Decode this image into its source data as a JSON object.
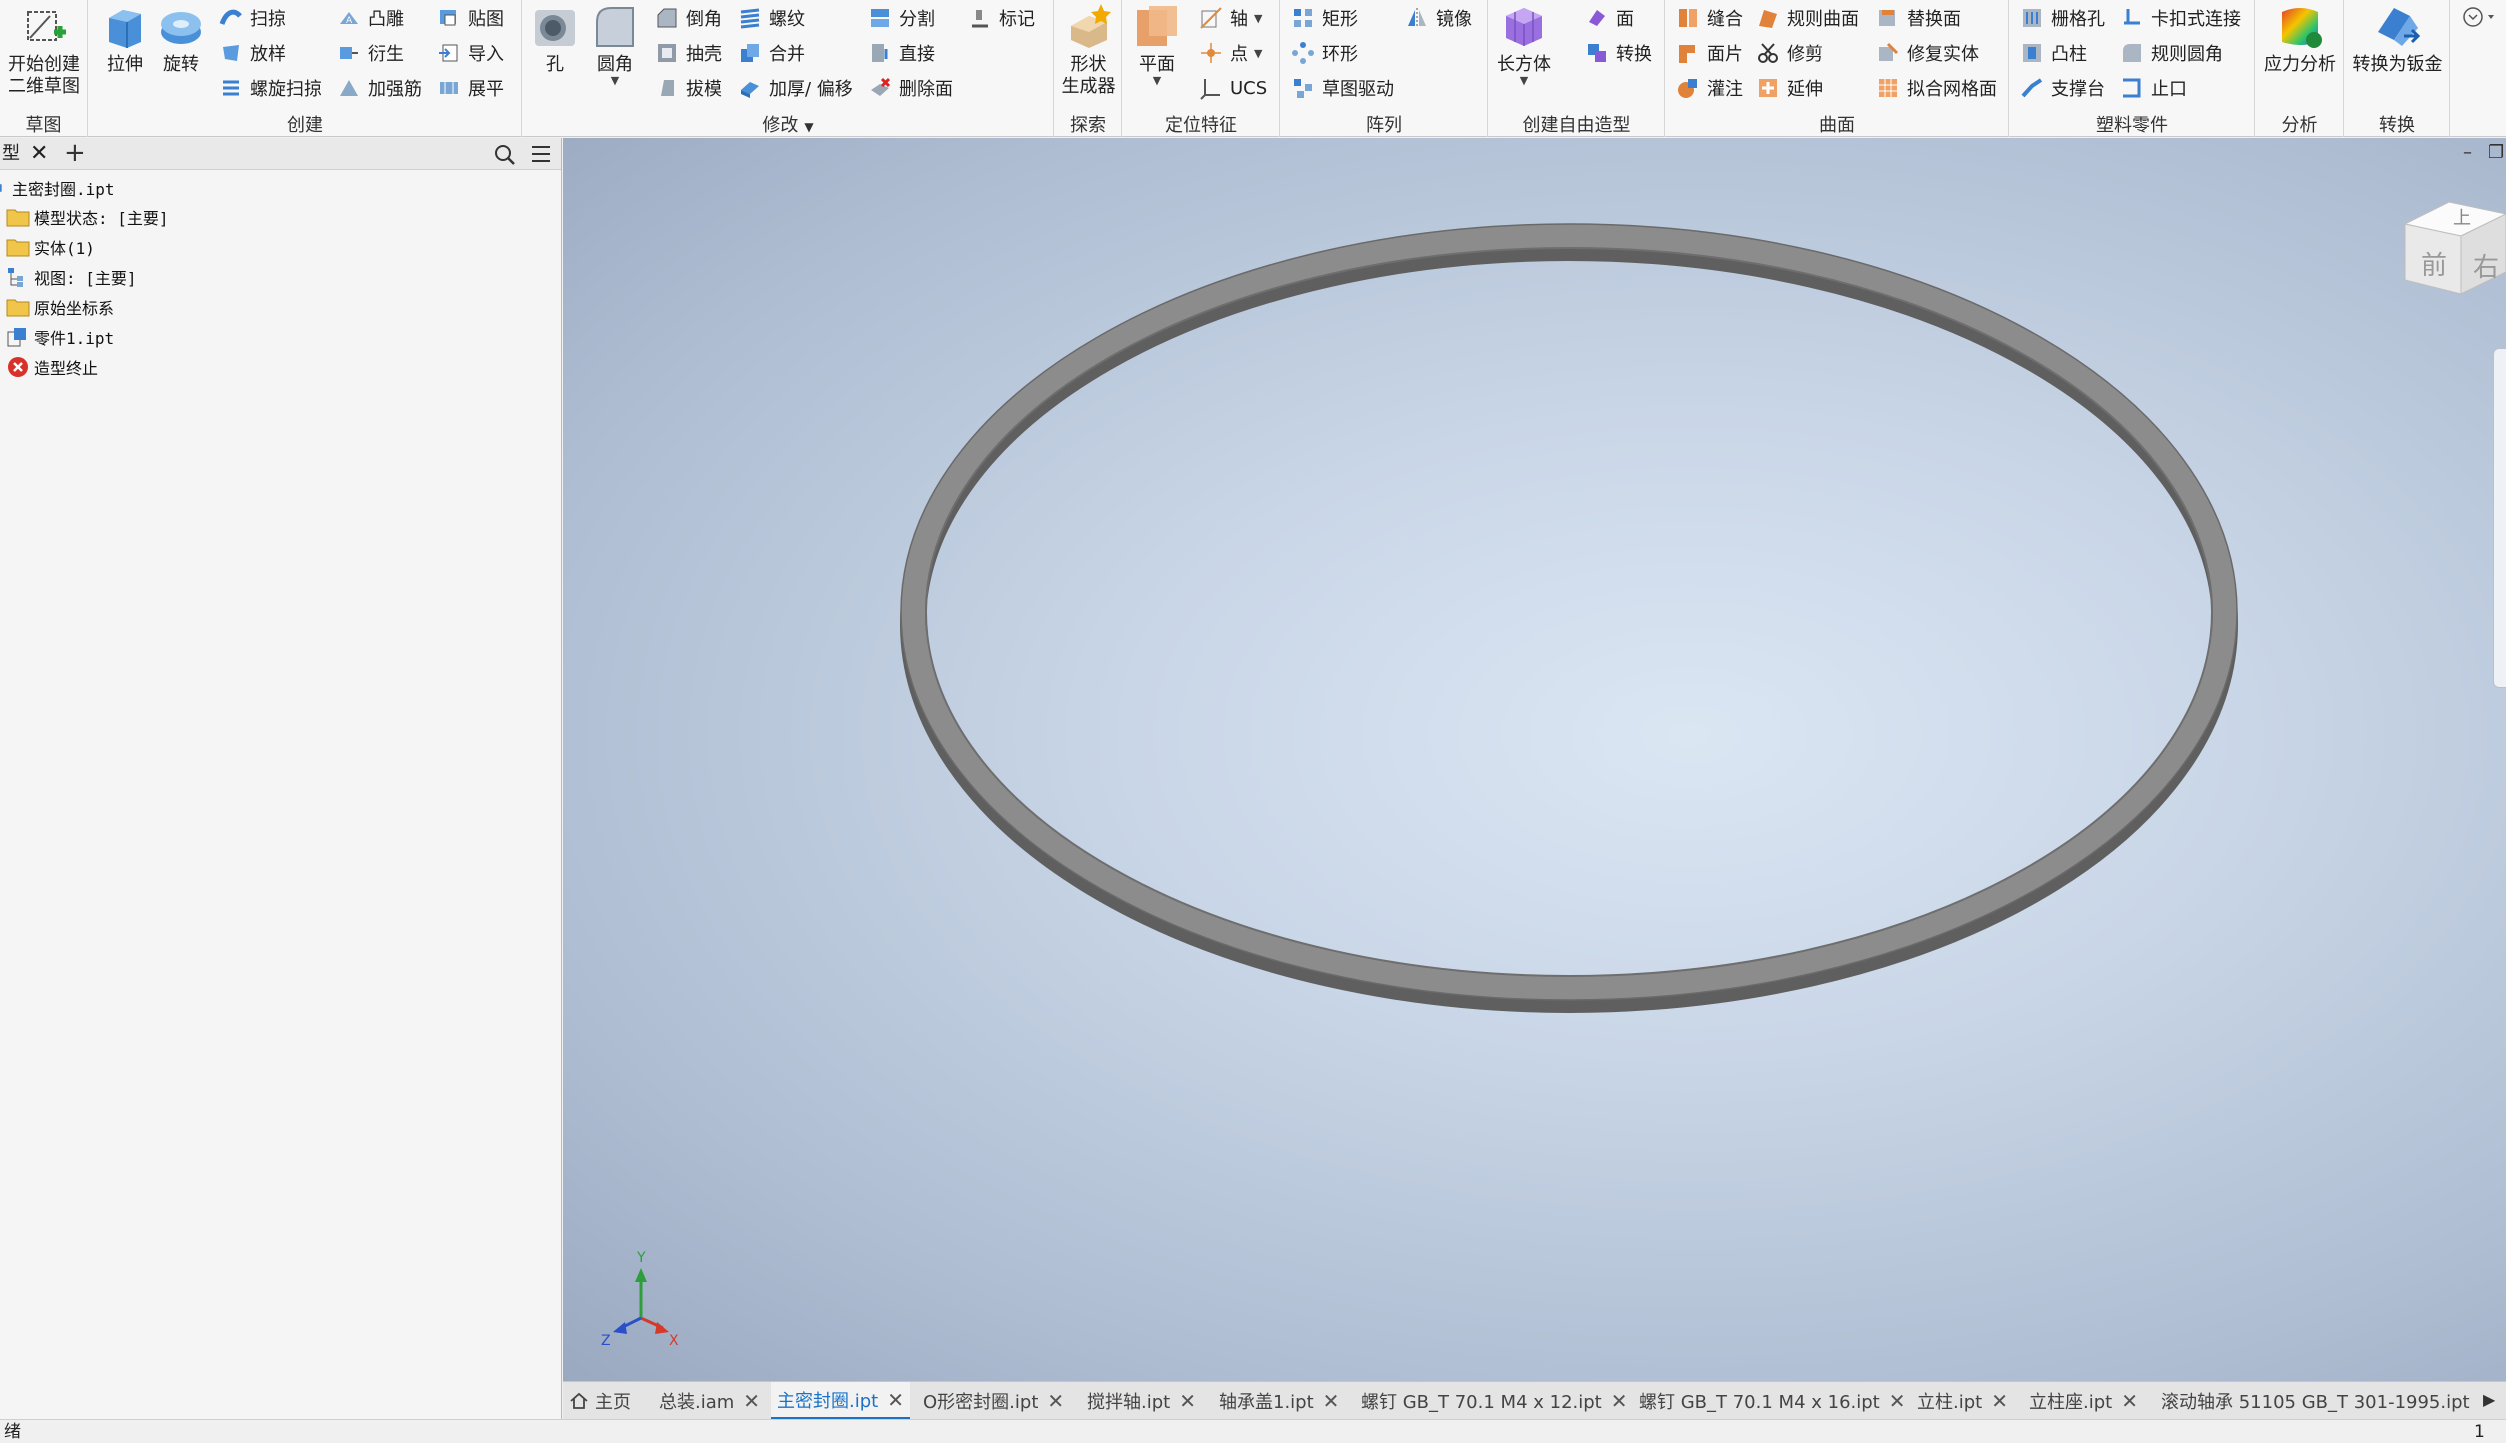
{
  "ribbon": {
    "sketch": {
      "panel_label": "草图",
      "start_sketch": {
        "line1": "开始创建",
        "line2": "二维草图"
      }
    },
    "create": {
      "panel_label": "创建",
      "extrude": "拉伸",
      "revolve": "旋转",
      "sweep": "扫掠",
      "loft": "放样",
      "coil": "螺旋扫掠",
      "emboss": "凸雕",
      "derive": "衍生",
      "rib": "加强筋",
      "decal": "贴图",
      "import": "导入",
      "unwrap": "展平"
    },
    "modify": {
      "panel_label": "修改",
      "hole": "孔",
      "fillet": "圆角",
      "chamfer": "倒角",
      "shell": "抽壳",
      "draft": "拔模",
      "thread": "螺纹",
      "combine": "合并",
      "thicken": "加厚/ 偏移",
      "split": "分割",
      "direct": "直接",
      "delete_face": "删除面",
      "mark": "标记"
    },
    "explore": {
      "panel_label": "探索",
      "shape_generator": {
        "line1": "形状",
        "line2": "生成器"
      }
    },
    "work_features": {
      "panel_label": "定位特征",
      "plane": "平面",
      "axis": "轴",
      "point": "点",
      "ucs": "UCS"
    },
    "pattern": {
      "panel_label": "阵列",
      "rectangular": "矩形",
      "circular": "环形",
      "sketch_driven": "草图驱动",
      "mirror": "镜像"
    },
    "freeform": {
      "panel_label": "创建自由造型",
      "box": "长方体",
      "face": "面",
      "convert": "转换"
    },
    "surface": {
      "panel_label": "曲面",
      "stitch": "缝合",
      "patch": "面片",
      "sculpt": "灌注",
      "ruled": "规则曲面",
      "trim": "修剪",
      "extend": "延伸",
      "replace_face": "替换面",
      "repair": "修复实体",
      "fit_mesh": "拟合网格面"
    },
    "plastic": {
      "panel_label": "塑料零件",
      "grill": "栅格孔",
      "boss": "凸柱",
      "rest": "支撑台",
      "snap_fit": "卡扣式连接",
      "rule_fillet": "规则圆角",
      "lip": "止口"
    },
    "analysis": {
      "panel_label": "分析",
      "stress": "应力分析"
    },
    "convert": {
      "panel_label": "转换",
      "to_sheet_metal": "转换为钣金"
    }
  },
  "browser": {
    "tab_label": "型",
    "items": [
      {
        "label": "主密封圈.ipt",
        "icon": "part-icon"
      },
      {
        "label": "模型状态: [主要]",
        "icon": "folder-icon"
      },
      {
        "label": "实体(1)",
        "icon": "folder-icon"
      },
      {
        "label": "视图: [主要]",
        "icon": "view-icon"
      },
      {
        "label": "原始坐标系",
        "icon": "folder-icon"
      },
      {
        "label": "零件1.ipt",
        "icon": "derived-part-icon"
      },
      {
        "label": "造型终止",
        "icon": "end-of-part-icon"
      }
    ]
  },
  "viewcube": {
    "top": "上",
    "front": "前",
    "right": "右"
  },
  "triad": {
    "x": "X",
    "y": "Y",
    "z": "Z"
  },
  "doc_tabs": [
    {
      "label": "主页",
      "closable": false,
      "active": false
    },
    {
      "label": "总装.iam",
      "closable": true,
      "active": false
    },
    {
      "label": "主密封圈.ipt",
      "closable": true,
      "active": true
    },
    {
      "label": "O形密封圈.ipt",
      "closable": true,
      "active": false
    },
    {
      "label": "搅拌轴.ipt",
      "closable": true,
      "active": false
    },
    {
      "label": "轴承盖1.ipt",
      "closable": true,
      "active": false
    },
    {
      "label": "螺钉 GB_T 70.1 M4 x 12.ipt",
      "closable": true,
      "active": false
    },
    {
      "label": "螺钉 GB_T 70.1 M4 x 16.ipt",
      "closable": true,
      "active": false
    },
    {
      "label": "立柱.ipt",
      "closable": true,
      "active": false
    },
    {
      "label": "立柱座.ipt",
      "closable": true,
      "active": false
    },
    {
      "label": "滚动轴承 51105 GB_T 301-1995.ipt",
      "closable": false,
      "active": false
    }
  ],
  "status": {
    "left": "绪",
    "right": "1"
  },
  "colors": {
    "accent": "#1a73c7",
    "ring": "#8a8a8a"
  }
}
